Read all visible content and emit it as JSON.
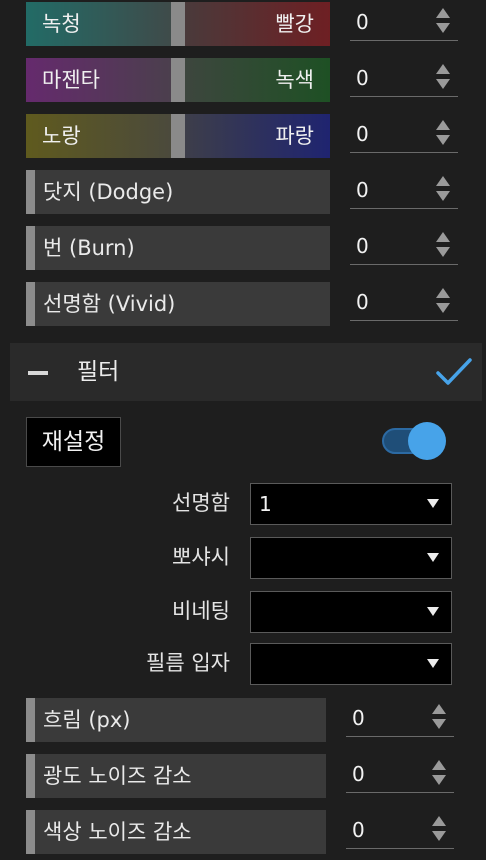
{
  "color_balance": [
    {
      "left": "녹청",
      "right": "빨강",
      "value": "0",
      "left_color": "#1d5f5a",
      "right_color": "#6b1f22"
    },
    {
      "left": "마젠타",
      "right": "녹색",
      "value": "0",
      "left_color": "#5b2a62",
      "right_color": "#1f4a24"
    },
    {
      "left": "노랑",
      "right": "파랑",
      "value": "0",
      "left_color": "#5b5420",
      "right_color": "#1f2766"
    }
  ],
  "tone": [
    {
      "label": "닷지 (Dodge)",
      "value": "0"
    },
    {
      "label": "번 (Burn)",
      "value": "0"
    },
    {
      "label": "선명함 (Vivid)",
      "value": "0"
    }
  ],
  "filter_section": {
    "title": "필터",
    "reset_label": "재설정",
    "accent": "#47a3e9"
  },
  "filters": [
    {
      "label": "선명함",
      "value": "1"
    },
    {
      "label": "뽀샤시",
      "value": ""
    },
    {
      "label": "비네팅",
      "value": ""
    },
    {
      "label": "필름 입자",
      "value": ""
    }
  ],
  "noise": [
    {
      "label": "흐림 (px)",
      "value": "0"
    },
    {
      "label": "광도 노이즈 감소",
      "value": "0"
    },
    {
      "label": "색상 노이즈 감소",
      "value": "0"
    }
  ]
}
